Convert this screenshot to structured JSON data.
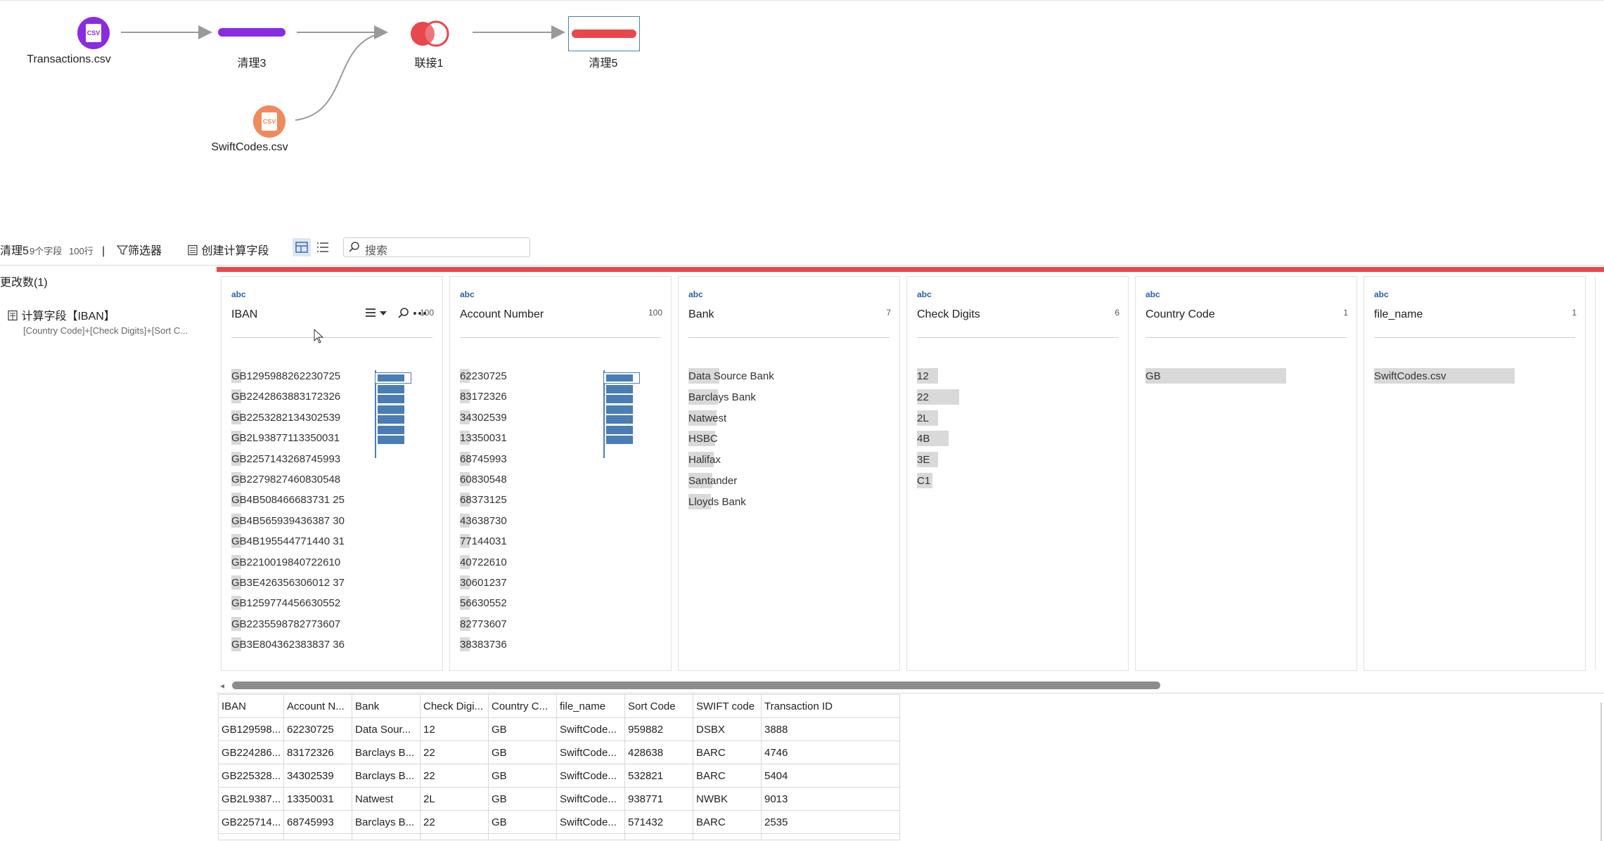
{
  "flow": {
    "nodes": [
      {
        "label": "Transactions.csv",
        "color": "#8a2be2"
      },
      {
        "label": "清理3",
        "color": "#8a2be2"
      },
      {
        "label": "联接1",
        "color": "#e8474c"
      },
      {
        "label": "清理5",
        "color": "#e8474c"
      },
      {
        "label": "SwiftCodes.csv",
        "color": "#f08a5d"
      }
    ],
    "csv_icon_text": "CSV"
  },
  "toolbar": {
    "step_name": "清理5",
    "fields_count": "9个字段",
    "rows_count": "100行",
    "separator": "|",
    "filter_label": "筛选器",
    "calc_field_label": "创建计算字段",
    "search_placeholder": "搜索"
  },
  "changes": {
    "title": "更改数(1)",
    "item_label": "计算字段【IBAN】",
    "item_desc": "[Country Code]+[Check Digits]+[Sort C..."
  },
  "profile": {
    "type_label": "abc",
    "cards": [
      {
        "name": "IBAN",
        "count": "100",
        "values": [
          "GB1295988262230725",
          "GB2242863883172326",
          "GB2253282134302539",
          "GB2L93877113350031",
          "GB2257143268745993",
          "GB2279827460830548",
          "GB4B508466683731 25",
          "GB4B565939436387 30",
          "GB4B195544771440 31",
          "GB2210019840722610",
          "GB3E426356306012 37",
          "GB1259774456630552",
          "GB2235598782773607",
          "GB3E804362383837 36"
        ]
      },
      {
        "name": "Account Number",
        "count": "100",
        "values": [
          "62230725",
          "83172326",
          "34302539",
          "13350031",
          "68745993",
          "60830548",
          "68373125",
          "43638730",
          "77144031",
          "40722610",
          "30601237",
          "56630552",
          "82773607",
          "38383736"
        ]
      },
      {
        "name": "Bank",
        "count": "7",
        "values": [
          "Data Source Bank",
          "Barclays Bank",
          "Natwest",
          "HSBC",
          "Halifax",
          "Santander",
          "Lloyds Bank"
        ]
      },
      {
        "name": "Check Digits",
        "count": "6",
        "values": [
          "12",
          "22",
          "2L",
          "4B",
          "3E",
          "C1"
        ]
      },
      {
        "name": "Country Code",
        "count": "1",
        "values": [
          "GB"
        ]
      },
      {
        "name": "file_name",
        "count": "1",
        "values": [
          "SwiftCodes.csv"
        ]
      }
    ]
  },
  "grid": {
    "columns": [
      "IBAN",
      "Account N...",
      "Bank",
      "Check Digi...",
      "Country C...",
      "file_name",
      "Sort Code",
      "SWIFT code",
      "Transaction ID"
    ],
    "rows": [
      [
        "GB129598...",
        "62230725",
        "Data Sour...",
        "12",
        "GB",
        "SwiftCode...",
        "959882",
        "DSBX",
        "3888"
      ],
      [
        "GB224286...",
        "83172326",
        "Barclays B...",
        "22",
        "GB",
        "SwiftCode...",
        "428638",
        "BARC",
        "4746"
      ],
      [
        "GB225328...",
        "34302539",
        "Barclays B...",
        "22",
        "GB",
        "SwiftCode...",
        "532821",
        "BARC",
        "5404"
      ],
      [
        "GB2L9387...",
        "13350031",
        "Natwest",
        "2L",
        "GB",
        "SwiftCode...",
        "938771",
        "NWBK",
        "9013"
      ],
      [
        "GB225714...",
        "68745993",
        "Barclays B...",
        "22",
        "GB",
        "SwiftCode...",
        "571432",
        "BARC",
        "2535"
      ]
    ]
  },
  "colors": {
    "accent_red": "#e8474c",
    "purple": "#8a2be2",
    "orange": "#f08a5d",
    "bar_blue": "#4a7db4"
  }
}
